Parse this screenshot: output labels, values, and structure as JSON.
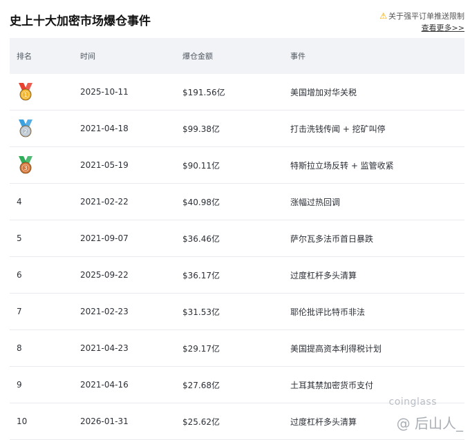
{
  "title": "史上十大加密市场爆仓事件",
  "notice": {
    "text": "关于强平订单推送限制",
    "link": "查看更多>>"
  },
  "columns": [
    "排名",
    "时间",
    "爆仓金额",
    "事件"
  ],
  "rows": [
    {
      "rank": "1",
      "date": "2025-10-11",
      "amount": "$191.56亿",
      "event": "美国增加对华关税"
    },
    {
      "rank": "2",
      "date": "2021-04-18",
      "amount": "$99.38亿",
      "event": "打击洗钱传闻 + 挖矿叫停"
    },
    {
      "rank": "3",
      "date": "2021-05-19",
      "amount": "$90.11亿",
      "event": "特斯拉立场反转 + 监管收紧"
    },
    {
      "rank": "4",
      "date": "2021-02-22",
      "amount": "$40.98亿",
      "event": "涨幅过热回调"
    },
    {
      "rank": "5",
      "date": "2021-09-07",
      "amount": "$36.46亿",
      "event": "萨尔瓦多法币首日暴跌"
    },
    {
      "rank": "6",
      "date": "2025-09-22",
      "amount": "$36.17亿",
      "event": "过度杠杆多头清算"
    },
    {
      "rank": "7",
      "date": "2021-02-23",
      "amount": "$31.53亿",
      "event": "耶伦批评比特币非法"
    },
    {
      "rank": "8",
      "date": "2021-04-23",
      "amount": "$29.17亿",
      "event": "美国提高资本利得税计划"
    },
    {
      "rank": "9",
      "date": "2021-04-16",
      "amount": "$27.68亿",
      "event": "土耳其禁加密货币支付"
    },
    {
      "rank": "10",
      "date": "2026-01-31",
      "amount": "$25.62亿",
      "event": "过度杠杆多头清算"
    }
  ],
  "medals": [
    {
      "rank": "1",
      "ribbon": "#e8412f",
      "disc": "#f2b52b",
      "icon": "gold-medal-icon"
    },
    {
      "rank": "2",
      "ribbon": "#3aa0e0",
      "disc": "#b7c2cc",
      "icon": "silver-medal-icon"
    },
    {
      "rank": "3",
      "ribbon": "#2fae5a",
      "disc": "#d7763a",
      "icon": "bronze-medal-icon"
    }
  ],
  "watermark": {
    "brand": "coinglass",
    "author": "@ 后山人_"
  },
  "colors": {
    "header_bg": "#f1f3f6",
    "warning": "#f0a400"
  }
}
